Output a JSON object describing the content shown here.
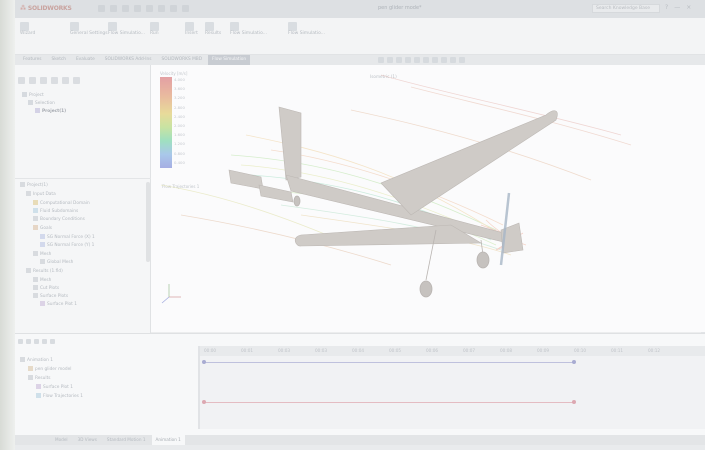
{
  "app": {
    "logo_text": "SOLIDWORKS",
    "document_title": "pen glider mode*",
    "search_placeholder": "Search Knowledge Base",
    "window_controls": [
      "?",
      "—",
      "×"
    ]
  },
  "ribbon": {
    "items": [
      {
        "label": "Wizard",
        "icon": "wizard-icon"
      },
      {
        "label": "General Settings",
        "icon": "settings-icon"
      },
      {
        "label": "Flow Simulatio...",
        "icon": "flow-sim-icon"
      },
      {
        "label": "Run",
        "icon": "run-icon"
      },
      {
        "label": "Insert",
        "icon": "insert-icon"
      },
      {
        "label": "Results",
        "icon": "results-icon"
      },
      {
        "label": "Flow Simulatio...",
        "icon": "flow-sim-icon-2"
      },
      {
        "label": "Flow Simulatio...",
        "icon": "flow-sim-icon-3"
      }
    ]
  },
  "tabs": [
    {
      "label": "Features",
      "active": false
    },
    {
      "label": "Sketch",
      "active": false
    },
    {
      "label": "Evaluate",
      "active": false
    },
    {
      "label": "SOLIDWORKS Add-Ins",
      "active": false
    },
    {
      "label": "SOLIDWORKS MBD",
      "active": false
    },
    {
      "label": "Flow Simulation",
      "active": true
    }
  ],
  "tree_top": [
    {
      "label": "Project",
      "level": 0
    },
    {
      "label": "Selection",
      "level": 1
    },
    {
      "label": "Project(1)",
      "level": 2,
      "selected": true
    }
  ],
  "tree_bottom": [
    {
      "label": "Project(1)",
      "level": 0
    },
    {
      "label": "Input Data",
      "level": 1
    },
    {
      "label": "Computational Domain",
      "level": 2
    },
    {
      "label": "Fluid Subdomains",
      "level": 2
    },
    {
      "label": "Boundary Conditions",
      "level": 2
    },
    {
      "label": "Goals",
      "level": 2
    },
    {
      "label": "SG Normal Force (X) 1",
      "level": 3
    },
    {
      "label": "SG Normal Force (Y) 1",
      "level": 3
    },
    {
      "label": "Mesh",
      "level": 2
    },
    {
      "label": "Global Mesh",
      "level": 3
    },
    {
      "label": "Results (1.fld)",
      "level": 1
    },
    {
      "label": "Mesh",
      "level": 2
    },
    {
      "label": "Cut Plots",
      "level": 2
    },
    {
      "label": "Surface Plots",
      "level": 2
    },
    {
      "label": "Surface Plot 1",
      "level": 3
    }
  ],
  "legend": {
    "title": "Velocity [m/s]",
    "values": [
      "4.000",
      "3.600",
      "3.200",
      "2.800",
      "2.400",
      "2.000",
      "1.600",
      "1.200",
      "0.800",
      "0.400"
    ],
    "caption": "Flow Trajectories 1"
  },
  "viewport": {
    "view_label": "Isometric (1)"
  },
  "bottom_tree": [
    {
      "label": "Animation 1",
      "level": 0
    },
    {
      "label": "pen glider model",
      "level": 1
    },
    {
      "label": "Results",
      "level": 1
    },
    {
      "label": "Surface Plot 1",
      "level": 2
    },
    {
      "label": "Flow Trajectories 1",
      "level": 2
    }
  ],
  "timeline": {
    "ticks": [
      "00:00",
      "00:01",
      "00:03",
      "00:03",
      "00:04",
      "00:05",
      "00:06",
      "00:07",
      "00:08",
      "00:09",
      "00:10",
      "00:11",
      "00:12"
    ]
  },
  "bottom_tabs": [
    {
      "label": "Model",
      "active": false
    },
    {
      "label": "3D Views",
      "active": false
    },
    {
      "label": "Standard Motion 1",
      "active": false
    },
    {
      "label": "Animation 1",
      "active": true
    }
  ],
  "colors": {
    "accent_active_tab": "#c8ccd2",
    "timeline_blue": "#b7b9d8",
    "timeline_red": "#e2b5bb",
    "model_surface": "#ccc8c5"
  }
}
